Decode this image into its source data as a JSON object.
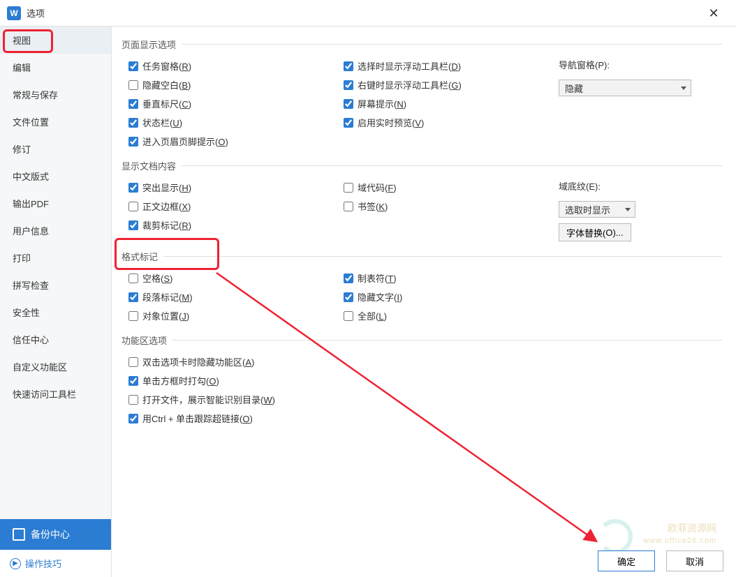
{
  "window": {
    "app_icon_letter": "W",
    "title": "选项",
    "close_glyph": "✕"
  },
  "sidebar": {
    "items": [
      "视图",
      "编辑",
      "常规与保存",
      "文件位置",
      "修订",
      "中文版式",
      "输出PDF",
      "用户信息",
      "打印",
      "拼写检查",
      "安全性",
      "信任中心",
      "自定义功能区",
      "快速访问工具栏"
    ],
    "active_index": 0,
    "backup_label": "备份中心",
    "tips_label": "操作技巧"
  },
  "sections": {
    "page_display": {
      "legend": "页面显示选项",
      "left": [
        {
          "label": "任务窗格(",
          "accel": "R",
          "suffix": ")",
          "checked": true
        },
        {
          "label": "隐藏空白(",
          "accel": "B",
          "suffix": ")",
          "checked": false
        },
        {
          "label": "垂直标尺(",
          "accel": "C",
          "suffix": ")",
          "checked": true
        },
        {
          "label": "状态栏(",
          "accel": "U",
          "suffix": ")",
          "checked": true
        },
        {
          "label": "进入页眉页脚提示(",
          "accel": "O",
          "suffix": ")",
          "checked": true
        }
      ],
      "mid": [
        {
          "label": "选择时显示浮动工具栏(",
          "accel": "D",
          "suffix": ")",
          "checked": true
        },
        {
          "label": "右键时显示浮动工具栏(",
          "accel": "G",
          "suffix": ")",
          "checked": true
        },
        {
          "label": "屏幕提示(",
          "accel": "N",
          "suffix": ")",
          "checked": true
        },
        {
          "label": "启用实时预览(",
          "accel": "V",
          "suffix": ")",
          "checked": true
        }
      ],
      "right": {
        "nav_label": "导航窗格(",
        "nav_accel": "P",
        "nav_suffix": "):",
        "nav_select_value": "隐藏"
      }
    },
    "doc_content": {
      "legend": "显示文档内容",
      "left": [
        {
          "label": "突出显示(",
          "accel": "H",
          "suffix": ")",
          "checked": true
        },
        {
          "label": "正文边框(",
          "accel": "X",
          "suffix": ")",
          "checked": false
        },
        {
          "label": "裁剪标记(",
          "accel": "R",
          "suffix": ")",
          "checked": true
        }
      ],
      "mid": [
        {
          "label": "域代码(",
          "accel": "F",
          "suffix": ")",
          "checked": false
        },
        {
          "label": "书签(",
          "accel": "K",
          "suffix": ")",
          "checked": false
        }
      ],
      "right": {
        "shade_label": "域底纹(",
        "shade_accel": "E",
        "shade_suffix": "):",
        "shade_select_value": "选取时显示",
        "font_btn": "字体替换(",
        "font_accel": "O",
        "font_suffix": ")..."
      }
    },
    "format_marks": {
      "legend": "格式标记",
      "left": [
        {
          "label": "空格(",
          "accel": "S",
          "suffix": ")",
          "checked": false
        },
        {
          "label": "段落标记(",
          "accel": "M",
          "suffix": ")",
          "checked": true
        },
        {
          "label": "对象位置(",
          "accel": "J",
          "suffix": ")",
          "checked": false
        }
      ],
      "mid": [
        {
          "label": "制表符(",
          "accel": "T",
          "suffix": ")",
          "checked": true
        },
        {
          "label": "隐藏文字(",
          "accel": "I",
          "suffix": ")",
          "checked": true
        },
        {
          "label": "全部(",
          "accel": "L",
          "suffix": ")",
          "checked": false
        }
      ]
    },
    "ribbon": {
      "legend": "功能区选项",
      "items": [
        {
          "label": "双击选项卡时隐藏功能区(",
          "accel": "A",
          "suffix": ")",
          "checked": false
        },
        {
          "label": "单击方框时打勾(",
          "accel": "O",
          "suffix": ")",
          "checked": true
        },
        {
          "label": "打开文件，展示智能识别目录(",
          "accel": "W",
          "suffix": ")",
          "checked": false
        },
        {
          "label": "用Ctrl + 单击跟踪超链接(",
          "accel": "O",
          "suffix": ")",
          "checked": true
        }
      ]
    }
  },
  "footer": {
    "ok": "确定",
    "cancel": "取消"
  },
  "watermark": {
    "l1": "欧菲资源网",
    "l2": "www.office26.com"
  }
}
